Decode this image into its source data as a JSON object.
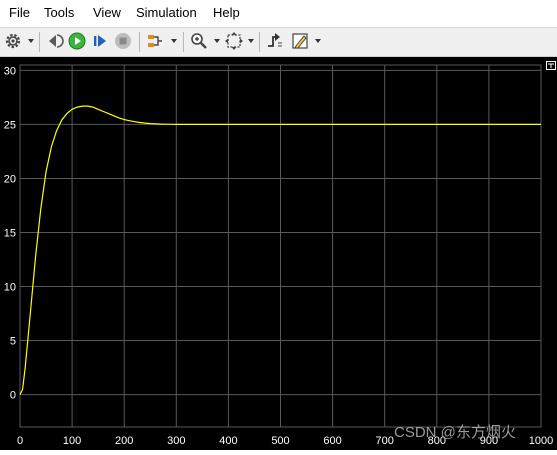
{
  "menu": {
    "items": [
      "File",
      "Tools",
      "View",
      "Simulation",
      "Help"
    ]
  },
  "toolbar": {
    "icons": [
      "settings-icon",
      "step-back-icon",
      "run-icon",
      "step-forward-icon",
      "stop-icon",
      "signal-selector-icon",
      "zoom-icon",
      "fit-to-view-icon",
      "triggers-icon",
      "style-icon"
    ]
  },
  "colors": {
    "background": "#000000",
    "grid": "#595959",
    "axis_text": "#ffffff",
    "signal": "#ffff00",
    "run_green": "#3cb53c"
  },
  "chart_data": {
    "type": "line",
    "title": "",
    "xlabel": "",
    "ylabel": "",
    "xlim": [
      0,
      1000
    ],
    "ylim": [
      -3,
      30.5
    ],
    "xticks": [
      0,
      100,
      200,
      300,
      400,
      500,
      600,
      700,
      800,
      900,
      1000
    ],
    "yticks": [
      0,
      5,
      10,
      15,
      20,
      25,
      30
    ],
    "grid": true,
    "series": [
      {
        "x": [
          0,
          5,
          10,
          20,
          30,
          40,
          50,
          60,
          70,
          80,
          90,
          100,
          110,
          120,
          130,
          140,
          150,
          160,
          170,
          180,
          190,
          200,
          210,
          220,
          230,
          240,
          250,
          260,
          270,
          280,
          290,
          300,
          320,
          350,
          400,
          500,
          600,
          700,
          800,
          900,
          1000
        ],
        "y": [
          0,
          0.5,
          2.5,
          7.6,
          12.8,
          17.2,
          20.6,
          22.9,
          24.4,
          25.4,
          26.0,
          26.4,
          26.6,
          26.7,
          26.7,
          26.6,
          26.4,
          26.2,
          26.0,
          25.8,
          25.6,
          25.45,
          25.35,
          25.25,
          25.18,
          25.12,
          25.08,
          25.05,
          25.03,
          25.02,
          25.01,
          25.0,
          25.0,
          25.0,
          25.0,
          25.0,
          25.0,
          25.0,
          25.0,
          25.0,
          25.0
        ]
      }
    ]
  },
  "watermark": "CSDN @东方烟火"
}
